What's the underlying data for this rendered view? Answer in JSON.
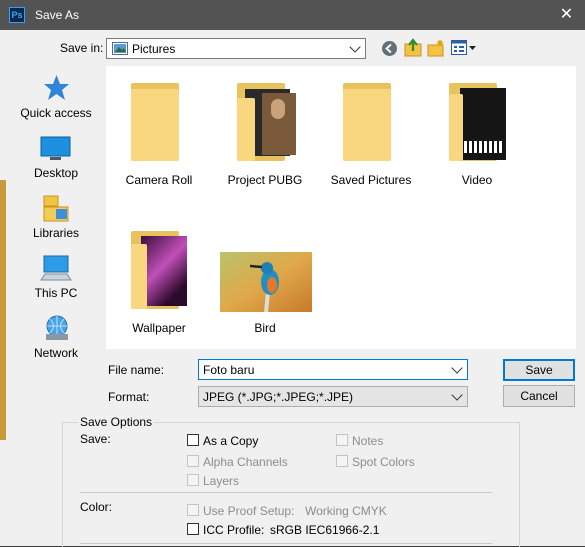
{
  "window": {
    "title": "Save As",
    "app_icon_text": "Ps",
    "close_glyph": "✕"
  },
  "save_in": {
    "label": "Save in:",
    "value": "Pictures"
  },
  "toolbar_icons": [
    "back-icon",
    "up-folder-icon",
    "new-folder-icon",
    "view-menu-icon"
  ],
  "nav": [
    {
      "label": "Quick access",
      "icon": "star-icon"
    },
    {
      "label": "Desktop",
      "icon": "desktop-icon"
    },
    {
      "label": "Libraries",
      "icon": "libraries-icon"
    },
    {
      "label": "This PC",
      "icon": "this-pc-icon"
    },
    {
      "label": "Network",
      "icon": "network-icon"
    }
  ],
  "files": [
    {
      "name": "Camera Roll",
      "type": "folder"
    },
    {
      "name": "Project PUBG",
      "type": "folder"
    },
    {
      "name": "Saved Pictures",
      "type": "folder"
    },
    {
      "name": "Video",
      "type": "folder"
    },
    {
      "name": "Wallpaper",
      "type": "folder"
    },
    {
      "name": "Bird",
      "type": "image"
    }
  ],
  "file_name": {
    "label": "File name:",
    "value": "Foto baru"
  },
  "format": {
    "label": "Format:",
    "value": "JPEG (*.JPG;*.JPEG;*.JPE)"
  },
  "buttons": {
    "save": "Save",
    "cancel": "Cancel"
  },
  "save_options": {
    "heading": "Save Options",
    "save_label": "Save:",
    "as_a_copy": "As a Copy",
    "notes": "Notes",
    "alpha_channels": "Alpha Channels",
    "spot_colors": "Spot Colors",
    "layers": "Layers"
  },
  "color": {
    "label": "Color:",
    "proof_setup": "Use Proof Setup:",
    "proof_value": "Working CMYK",
    "icc_profile": "ICC Profile:",
    "icc_value": "sRGB IEC61966-2.1"
  },
  "colors": {
    "titlebar": "#535353",
    "accent": "#0078d7",
    "folder": "#f9d77e"
  }
}
